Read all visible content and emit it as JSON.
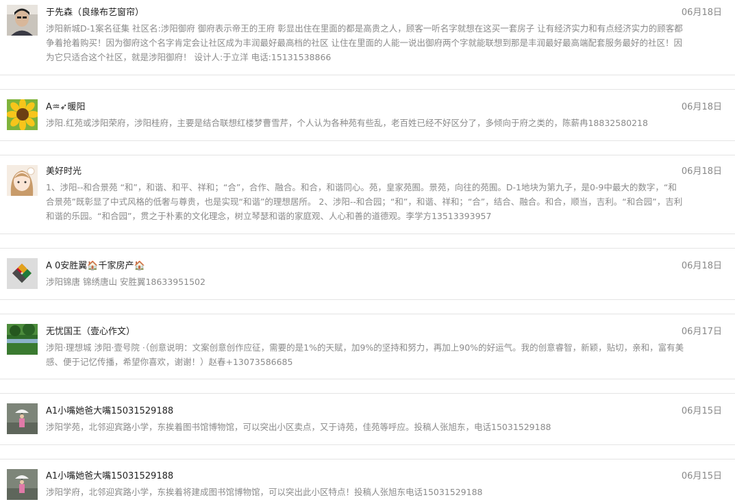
{
  "posts": [
    {
      "name": "于先森（良缘布艺窗帘）",
      "date": "06月18日",
      "content": "涉阳新城D-1案名征集 社区名:涉阳御府 御府表示帝王的王府 彰显出住在里面的都是高贵之人，顾客一听名字就想在这买一套房子 让有经济实力和有点经济实力的顾客都争着抢着购买！因为御府这个名字肯定会让社区成为丰润最好最高档的社区 让住在里面的人能一说出御府两个字就能联想到那是丰润最好最高端配套服务最好的社区！因为它只适合这个社区，就是涉阳御府！ 设计人:于立洋 电话:15131538866",
      "avatar_icon": "person-photo-icon"
    },
    {
      "name": "A♒➶暖阳",
      "date": "06月18日",
      "content": "涉阳.红苑或涉阳荣府，涉阳桂府，主要是结合联想红楼梦曹雪芹，个人认为各种苑有些乱，老百姓已经不好区分了，多倾向于府之类的，陈薪冉18832580218",
      "avatar_icon": "sunflower-icon"
    },
    {
      "name": "美好时光",
      "date": "06月18日",
      "content": "1、涉阳--和合景苑 “和”，和谐、和平、祥和；“合”，合作、融合。和合，和谐同心。苑，皇家苑囿。景苑，向往的苑囿。D-1地块为第九子，是0-9中最大的数字，“和合景苑”既彰显了中式风格的低奢与尊贵，也是实现“和谐”的理想居所。 2、涉阳--和合园；“和”，和谐、祥和；“合”，结合、融合。和合，顺当，吉利。“和合园”，吉利和谐的乐园。“和合园”，贯之于朴素的文化理念，树立琴瑟和谐的家庭观、人心和善的道德观。李学方13513393957",
      "avatar_icon": "anime-girl-icon"
    },
    {
      "name": "A 0安胜翼🏠千家房产🏠",
      "date": "06月18日",
      "content": "涉阳锦唐 锦绣唐山 安胜翼18633951502",
      "avatar_icon": "logo-icon"
    },
    {
      "name": "无忧国王（壹心作文）",
      "date": "06月17日",
      "content": "涉阳·理想城 涉阳·壹号院 ·（创意说明：文案创意创作应征，需要的是1%的天赋，加9%的坚持和努力，再加上90%的好运气。我的创意睿智，新颖，贴切，亲和，富有美感、便于记忆传播，希望你喜欢，谢谢！）赵春+13073586685",
      "avatar_icon": "landscape-icon"
    },
    {
      "name": "A1小嘴她爸大嘴15031529188",
      "date": "06月15日",
      "content": "涉阳学苑，北邻迎宾路小学，东挨着图书馆博物馆，可以突出小区卖点，又于诗苑，佳苑等呼应。投稿人张旭东，电话15031529188",
      "avatar_icon": "umbrella-child-icon"
    },
    {
      "name": "A1小嘴她爸大嘴15031529188",
      "date": "06月15日",
      "content": "涉阳学府，北邻迎宾路小学，东挨着将建成图书馆博物馆，可以突出此小区特点！投稿人张旭东电话15031529188",
      "avatar_icon": "umbrella-child-icon"
    }
  ]
}
